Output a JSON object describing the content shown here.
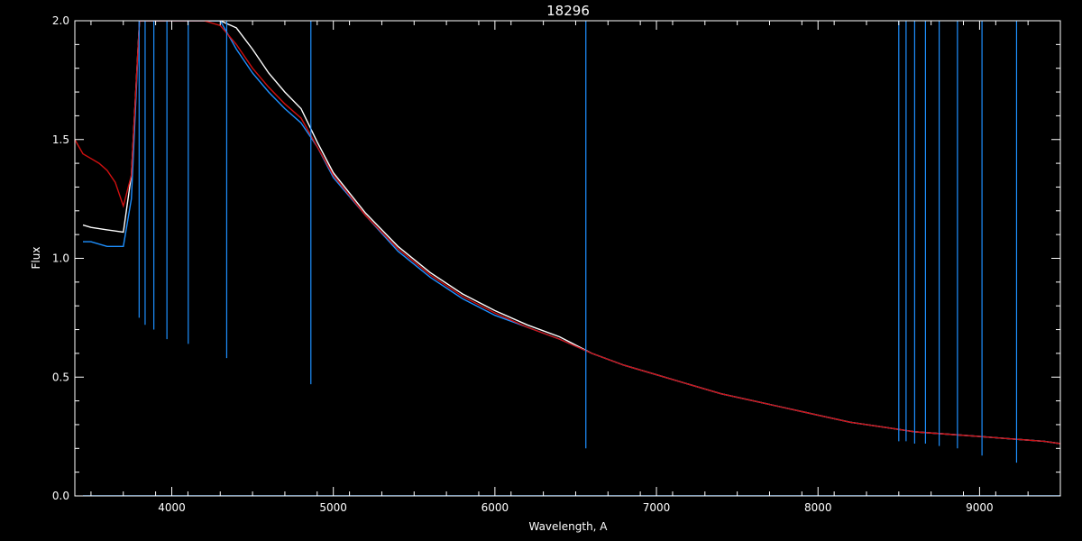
{
  "chart_data": {
    "type": "line",
    "title": "18296",
    "xlabel": "Wavelength, A",
    "ylabel": "Flux",
    "xlim": [
      3400,
      9500
    ],
    "ylim": [
      0.0,
      2.0
    ],
    "x_ticks": [
      4000,
      5000,
      6000,
      7000,
      8000,
      9000
    ],
    "x_tick_labels": [
      "4000",
      "5000",
      "6000",
      "7000",
      "8000",
      "9000"
    ],
    "y_ticks": [
      0.0,
      0.5,
      1.0,
      1.5,
      2.0
    ],
    "y_tick_labels": [
      "0.0",
      "0.5",
      "1.0",
      "1.5",
      "2.0"
    ],
    "grid": false,
    "legend": "none",
    "colors": {
      "background": "#000000",
      "axes": "#ffffff",
      "observed_upper": "#ffffff",
      "observed": "#1e90ff",
      "model": "#d01010"
    },
    "series": [
      {
        "color": "#ffffff",
        "x": [
          3450,
          3500,
          3600,
          3700,
          3750,
          3800,
          3900,
          4000,
          4100,
          4200,
          4300,
          4400,
          4500,
          4600,
          4700,
          4800,
          4900,
          5000,
          5200,
          5400,
          5600,
          5800,
          6000,
          6200,
          6400,
          6600,
          6800,
          7000,
          7200,
          7400,
          7600,
          7800,
          8000,
          8200,
          8400,
          8600,
          8800,
          9000,
          9200,
          9400,
          9500
        ],
        "y": [
          1.14,
          1.13,
          1.12,
          1.11,
          1.35,
          2.0,
          2.0,
          2.0,
          2.0,
          2.0,
          2.0,
          1.97,
          1.88,
          1.78,
          1.7,
          1.63,
          1.49,
          1.36,
          1.19,
          1.05,
          0.94,
          0.85,
          0.78,
          0.72,
          0.67,
          0.6,
          0.55,
          0.51,
          0.47,
          0.43,
          0.4,
          0.37,
          0.34,
          0.31,
          0.29,
          0.27,
          0.26,
          0.25,
          0.24,
          0.23,
          0.22
        ]
      },
      {
        "color": "#1e90ff",
        "x": [
          3450,
          3500,
          3600,
          3700,
          3750,
          3800,
          3900,
          4000,
          4100,
          4200,
          4300,
          4400,
          4500,
          4600,
          4700,
          4800,
          4900,
          5000,
          5200,
          5400,
          5600,
          5800,
          6000,
          6200,
          6400,
          6600,
          6800,
          7000,
          7200,
          7400,
          7600,
          7800,
          8000,
          8200,
          8400,
          8600,
          8800,
          9000,
          9200,
          9400,
          9500
        ],
        "y": [
          1.07,
          1.07,
          1.05,
          1.05,
          1.25,
          2.0,
          2.0,
          2.0,
          2.0,
          2.0,
          2.0,
          1.88,
          1.78,
          1.7,
          1.63,
          1.57,
          1.47,
          1.34,
          1.18,
          1.03,
          0.92,
          0.83,
          0.76,
          0.71,
          0.66,
          0.6,
          0.55,
          0.51,
          0.47,
          0.43,
          0.4,
          0.37,
          0.34,
          0.31,
          0.29,
          0.27,
          0.26,
          0.25,
          0.24,
          0.23,
          0.22
        ]
      },
      {
        "color": "#d01010",
        "x": [
          3400,
          3450,
          3500,
          3550,
          3600,
          3650,
          3700,
          3750,
          3800,
          3900,
          4000,
          4100,
          4200,
          4300,
          4400,
          4500,
          4600,
          4700,
          4800,
          4900,
          5000,
          5200,
          5400,
          5600,
          5800,
          6000,
          6200,
          6400,
          6600,
          6800,
          7000,
          7200,
          7400,
          7600,
          7800,
          8000,
          8200,
          8400,
          8600,
          8800,
          9000,
          9200,
          9400,
          9500
        ],
        "y": [
          1.5,
          1.44,
          1.42,
          1.4,
          1.37,
          1.32,
          1.22,
          1.35,
          2.0,
          2.0,
          2.0,
          2.0,
          2.0,
          1.98,
          1.9,
          1.8,
          1.72,
          1.65,
          1.59,
          1.47,
          1.35,
          1.18,
          1.04,
          0.93,
          0.84,
          0.77,
          0.71,
          0.66,
          0.6,
          0.55,
          0.51,
          0.47,
          0.43,
          0.4,
          0.37,
          0.34,
          0.31,
          0.29,
          0.27,
          0.26,
          0.25,
          0.24,
          0.23,
          0.22
        ]
      },
      {
        "color": "#1e90ff",
        "x": [
          3450,
          4000,
          5000,
          6000,
          7000,
          8000,
          9000,
          9500
        ],
        "y": [
          0.0,
          0.0,
          0.0,
          0.0,
          0.0,
          0.0,
          0.0,
          0.0
        ]
      }
    ],
    "absorption_lines": [
      {
        "x": 3798,
        "y_min": 0.75
      },
      {
        "x": 3835,
        "y_min": 0.72
      },
      {
        "x": 3889,
        "y_min": 0.7
      },
      {
        "x": 3970,
        "y_min": 0.66
      },
      {
        "x": 4102,
        "y_min": 0.64
      },
      {
        "x": 4340,
        "y_min": 0.58
      },
      {
        "x": 4861,
        "y_min": 0.47
      },
      {
        "x": 6563,
        "y_min": 0.2
      },
      {
        "x": 8500,
        "y_min": 0.23
      },
      {
        "x": 8545,
        "y_min": 0.23
      },
      {
        "x": 8598,
        "y_min": 0.22
      },
      {
        "x": 8665,
        "y_min": 0.22
      },
      {
        "x": 8750,
        "y_min": 0.21
      },
      {
        "x": 8863,
        "y_min": 0.2
      },
      {
        "x": 9015,
        "y_min": 0.17
      },
      {
        "x": 9229,
        "y_min": 0.14
      }
    ]
  }
}
